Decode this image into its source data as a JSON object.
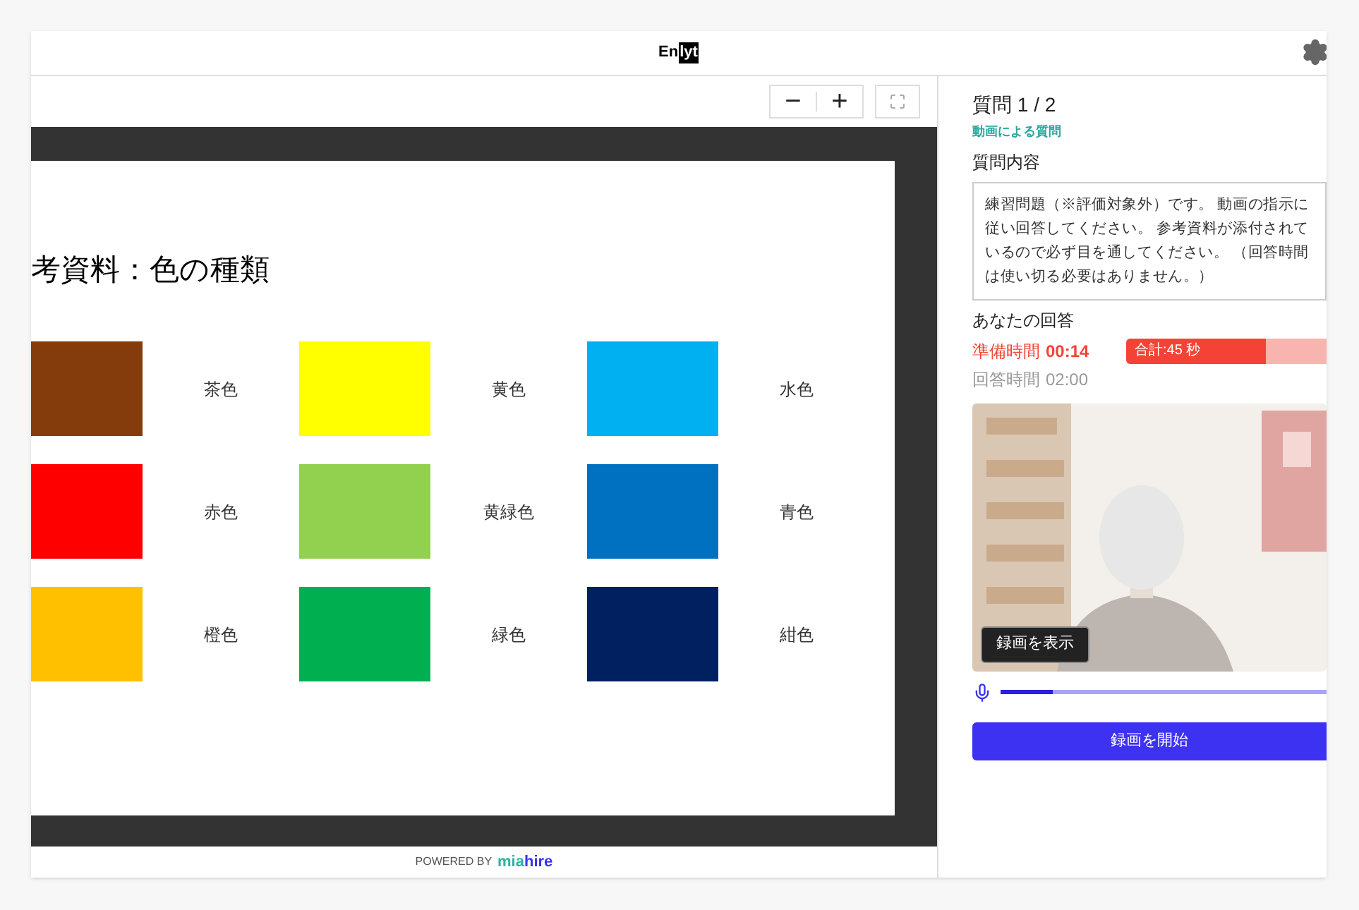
{
  "header": {
    "logo": {
      "dark_part": "En",
      "boxed_part": "lyt"
    }
  },
  "toolbar": {
    "zoom_out": "−",
    "zoom_in": "+"
  },
  "slide": {
    "title": "考資料：色の種類",
    "colors": [
      {
        "label": "茶色",
        "color": "#843c0c"
      },
      {
        "label": "黄色",
        "color": "#ffff00"
      },
      {
        "label": "水色",
        "color": "#00b0f0"
      },
      {
        "label": "赤色",
        "color": "#ff0000"
      },
      {
        "label": "黄緑色",
        "color": "#92d050"
      },
      {
        "label": "青色",
        "color": "#0070c0"
      },
      {
        "label": "橙色",
        "color": "#ffc000"
      },
      {
        "label": "緑色",
        "color": "#00b050"
      },
      {
        "label": "紺色",
        "color": "#002060"
      }
    ]
  },
  "footer": {
    "powered_by": "POWERED BY",
    "brand_a": "mia",
    "brand_b": "hire"
  },
  "question": {
    "title": "質問 1 / 2",
    "type": "動画による質問",
    "content_label": "質問内容",
    "content": "練習問題（※評価対象外）です。 動画の指示に従い回答してください。 参考資料が添付されているので必ず目を通してください。 （回答時間は使い切る必要はありません。）"
  },
  "answer": {
    "label": "あなたの回答",
    "prep_label": "準備時間",
    "prep_time": "00:14",
    "total": "合計:45 秒",
    "level": 0.7,
    "answer_label": "回答時間",
    "answer_time": "02:00",
    "video": {
      "kind": "picture",
      "show_button": "録画を表示"
    },
    "mic": {
      "level": 0.16
    },
    "start_button": "録画を開始"
  }
}
